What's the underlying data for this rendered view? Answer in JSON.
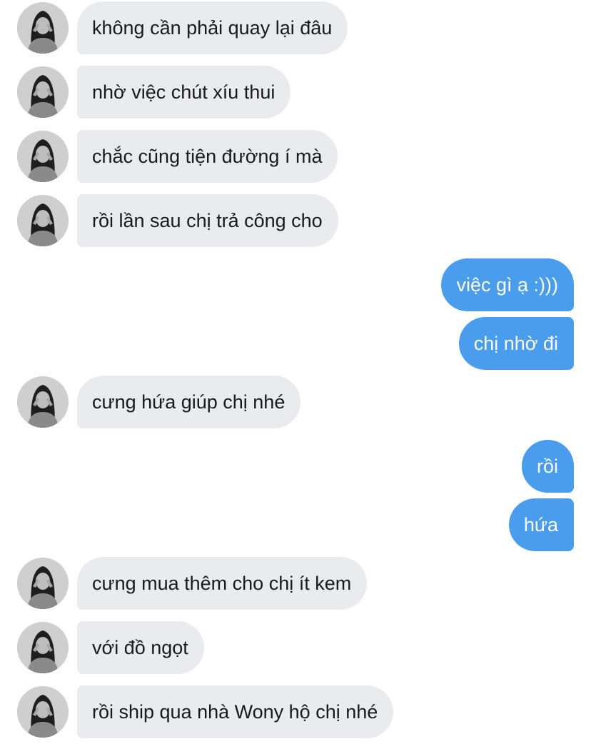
{
  "chat": {
    "messages": [
      {
        "side": "in",
        "text": "không cần phải quay lại đâu"
      },
      {
        "side": "in",
        "text": "nhờ việc chút xíu thui"
      },
      {
        "side": "in",
        "text": "chắc cũng tiện đường í mà"
      },
      {
        "side": "in",
        "text": "rồi lần sau chị trả công cho"
      },
      {
        "side": "out",
        "text": "việc gì ạ :)))"
      },
      {
        "side": "out",
        "text": "chị nhờ đi"
      },
      {
        "side": "in",
        "text": "cưng hứa giúp chị nhé"
      },
      {
        "side": "out",
        "text": "rồi"
      },
      {
        "side": "out",
        "text": "hứa"
      },
      {
        "side": "in",
        "text": "cưng mua thêm cho chị ít kem"
      },
      {
        "side": "in",
        "text": "với đồ ngọt"
      },
      {
        "side": "in",
        "text": "rồi ship qua nhà Wony hộ chị nhé"
      }
    ]
  },
  "colors": {
    "incoming_bubble": "#e9ebef",
    "outgoing_bubble": "#4a9cec",
    "incoming_text": "#1a1a1a",
    "outgoing_text": "#ffffff"
  },
  "icons": {
    "avatar": "profile-photo-avatar"
  }
}
